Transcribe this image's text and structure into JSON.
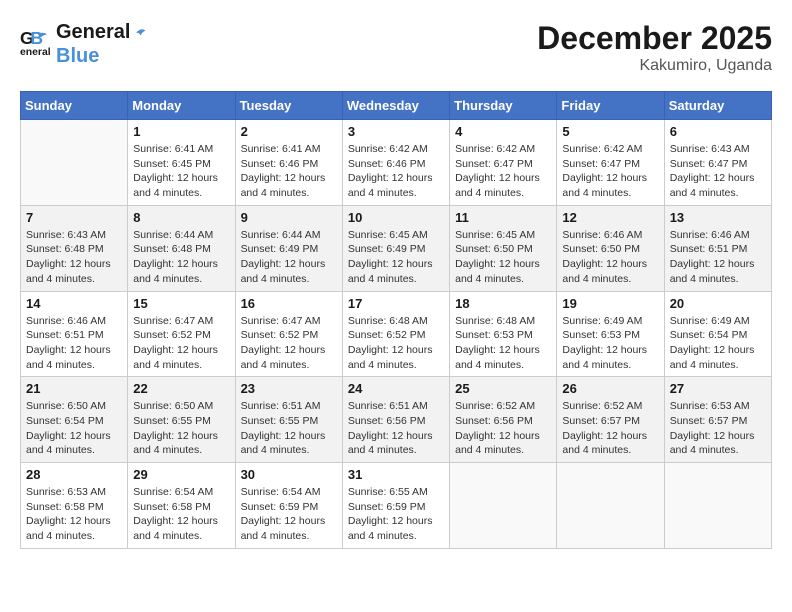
{
  "header": {
    "logo_line1": "General",
    "logo_line2": "Blue",
    "title": "December 2025",
    "subtitle": "Kakumiro, Uganda"
  },
  "weekdays": [
    "Sunday",
    "Monday",
    "Tuesday",
    "Wednesday",
    "Thursday",
    "Friday",
    "Saturday"
  ],
  "weeks": [
    [
      {
        "day": "",
        "sunrise": "",
        "sunset": "",
        "daylight": ""
      },
      {
        "day": "1",
        "sunrise": "Sunrise: 6:41 AM",
        "sunset": "Sunset: 6:45 PM",
        "daylight": "Daylight: 12 hours and 4 minutes."
      },
      {
        "day": "2",
        "sunrise": "Sunrise: 6:41 AM",
        "sunset": "Sunset: 6:46 PM",
        "daylight": "Daylight: 12 hours and 4 minutes."
      },
      {
        "day": "3",
        "sunrise": "Sunrise: 6:42 AM",
        "sunset": "Sunset: 6:46 PM",
        "daylight": "Daylight: 12 hours and 4 minutes."
      },
      {
        "day": "4",
        "sunrise": "Sunrise: 6:42 AM",
        "sunset": "Sunset: 6:47 PM",
        "daylight": "Daylight: 12 hours and 4 minutes."
      },
      {
        "day": "5",
        "sunrise": "Sunrise: 6:42 AM",
        "sunset": "Sunset: 6:47 PM",
        "daylight": "Daylight: 12 hours and 4 minutes."
      },
      {
        "day": "6",
        "sunrise": "Sunrise: 6:43 AM",
        "sunset": "Sunset: 6:47 PM",
        "daylight": "Daylight: 12 hours and 4 minutes."
      }
    ],
    [
      {
        "day": "7",
        "sunrise": "Sunrise: 6:43 AM",
        "sunset": "Sunset: 6:48 PM",
        "daylight": "Daylight: 12 hours and 4 minutes."
      },
      {
        "day": "8",
        "sunrise": "Sunrise: 6:44 AM",
        "sunset": "Sunset: 6:48 PM",
        "daylight": "Daylight: 12 hours and 4 minutes."
      },
      {
        "day": "9",
        "sunrise": "Sunrise: 6:44 AM",
        "sunset": "Sunset: 6:49 PM",
        "daylight": "Daylight: 12 hours and 4 minutes."
      },
      {
        "day": "10",
        "sunrise": "Sunrise: 6:45 AM",
        "sunset": "Sunset: 6:49 PM",
        "daylight": "Daylight: 12 hours and 4 minutes."
      },
      {
        "day": "11",
        "sunrise": "Sunrise: 6:45 AM",
        "sunset": "Sunset: 6:50 PM",
        "daylight": "Daylight: 12 hours and 4 minutes."
      },
      {
        "day": "12",
        "sunrise": "Sunrise: 6:46 AM",
        "sunset": "Sunset: 6:50 PM",
        "daylight": "Daylight: 12 hours and 4 minutes."
      },
      {
        "day": "13",
        "sunrise": "Sunrise: 6:46 AM",
        "sunset": "Sunset: 6:51 PM",
        "daylight": "Daylight: 12 hours and 4 minutes."
      }
    ],
    [
      {
        "day": "14",
        "sunrise": "Sunrise: 6:46 AM",
        "sunset": "Sunset: 6:51 PM",
        "daylight": "Daylight: 12 hours and 4 minutes."
      },
      {
        "day": "15",
        "sunrise": "Sunrise: 6:47 AM",
        "sunset": "Sunset: 6:52 PM",
        "daylight": "Daylight: 12 hours and 4 minutes."
      },
      {
        "day": "16",
        "sunrise": "Sunrise: 6:47 AM",
        "sunset": "Sunset: 6:52 PM",
        "daylight": "Daylight: 12 hours and 4 minutes."
      },
      {
        "day": "17",
        "sunrise": "Sunrise: 6:48 AM",
        "sunset": "Sunset: 6:52 PM",
        "daylight": "Daylight: 12 hours and 4 minutes."
      },
      {
        "day": "18",
        "sunrise": "Sunrise: 6:48 AM",
        "sunset": "Sunset: 6:53 PM",
        "daylight": "Daylight: 12 hours and 4 minutes."
      },
      {
        "day": "19",
        "sunrise": "Sunrise: 6:49 AM",
        "sunset": "Sunset: 6:53 PM",
        "daylight": "Daylight: 12 hours and 4 minutes."
      },
      {
        "day": "20",
        "sunrise": "Sunrise: 6:49 AM",
        "sunset": "Sunset: 6:54 PM",
        "daylight": "Daylight: 12 hours and 4 minutes."
      }
    ],
    [
      {
        "day": "21",
        "sunrise": "Sunrise: 6:50 AM",
        "sunset": "Sunset: 6:54 PM",
        "daylight": "Daylight: 12 hours and 4 minutes."
      },
      {
        "day": "22",
        "sunrise": "Sunrise: 6:50 AM",
        "sunset": "Sunset: 6:55 PM",
        "daylight": "Daylight: 12 hours and 4 minutes."
      },
      {
        "day": "23",
        "sunrise": "Sunrise: 6:51 AM",
        "sunset": "Sunset: 6:55 PM",
        "daylight": "Daylight: 12 hours and 4 minutes."
      },
      {
        "day": "24",
        "sunrise": "Sunrise: 6:51 AM",
        "sunset": "Sunset: 6:56 PM",
        "daylight": "Daylight: 12 hours and 4 minutes."
      },
      {
        "day": "25",
        "sunrise": "Sunrise: 6:52 AM",
        "sunset": "Sunset: 6:56 PM",
        "daylight": "Daylight: 12 hours and 4 minutes."
      },
      {
        "day": "26",
        "sunrise": "Sunrise: 6:52 AM",
        "sunset": "Sunset: 6:57 PM",
        "daylight": "Daylight: 12 hours and 4 minutes."
      },
      {
        "day": "27",
        "sunrise": "Sunrise: 6:53 AM",
        "sunset": "Sunset: 6:57 PM",
        "daylight": "Daylight: 12 hours and 4 minutes."
      }
    ],
    [
      {
        "day": "28",
        "sunrise": "Sunrise: 6:53 AM",
        "sunset": "Sunset: 6:58 PM",
        "daylight": "Daylight: 12 hours and 4 minutes."
      },
      {
        "day": "29",
        "sunrise": "Sunrise: 6:54 AM",
        "sunset": "Sunset: 6:58 PM",
        "daylight": "Daylight: 12 hours and 4 minutes."
      },
      {
        "day": "30",
        "sunrise": "Sunrise: 6:54 AM",
        "sunset": "Sunset: 6:59 PM",
        "daylight": "Daylight: 12 hours and 4 minutes."
      },
      {
        "day": "31",
        "sunrise": "Sunrise: 6:55 AM",
        "sunset": "Sunset: 6:59 PM",
        "daylight": "Daylight: 12 hours and 4 minutes."
      },
      {
        "day": "",
        "sunrise": "",
        "sunset": "",
        "daylight": ""
      },
      {
        "day": "",
        "sunrise": "",
        "sunset": "",
        "daylight": ""
      },
      {
        "day": "",
        "sunrise": "",
        "sunset": "",
        "daylight": ""
      }
    ]
  ]
}
